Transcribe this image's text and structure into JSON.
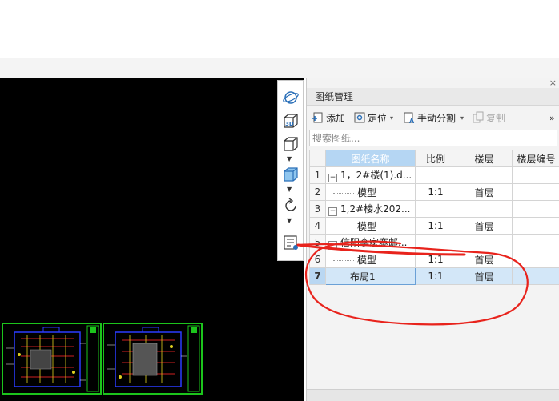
{
  "panel": {
    "title": "图纸管理",
    "close_icon": "×",
    "toolbar": {
      "add_label": "添加",
      "locate_label": "定位",
      "split_label": "手动分割",
      "copy_label": "复制",
      "more_icon": "»"
    },
    "search_placeholder": "搜索图纸..."
  },
  "table": {
    "headers": [
      "",
      "图纸名称",
      "比例",
      "楼层",
      "楼层编号"
    ],
    "rows": [
      {
        "no": "1",
        "name": "1，2#楼(1).d...",
        "scale": "",
        "floor": "",
        "floor_no": "",
        "expander": "−"
      },
      {
        "no": "2",
        "name": "模型",
        "scale": "1:1",
        "floor": "首层",
        "floor_no": ""
      },
      {
        "no": "3",
        "name": "1,2#楼水202...",
        "scale": "",
        "floor": "",
        "floor_no": "",
        "expander": "−"
      },
      {
        "no": "4",
        "name": "模型",
        "scale": "1:1",
        "floor": "首层",
        "floor_no": ""
      },
      {
        "no": "5",
        "name": "信阳李家寨邮...",
        "scale": "",
        "floor": "",
        "floor_no": "",
        "expander": "−"
      },
      {
        "no": "6",
        "name": "模型",
        "scale": "1:1",
        "floor": "首层",
        "floor_no": ""
      },
      {
        "no": "7",
        "name": "布局1",
        "scale": "1:1",
        "floor": "首层",
        "floor_no": ""
      }
    ]
  },
  "view_toolbar": {
    "icons": [
      "orbit-icon",
      "3d-view-icon",
      "cube-view-icon",
      "cube-solid-icon",
      "rotate-icon",
      "layer-list-icon"
    ],
    "cube_3d_label": "3D"
  },
  "colors": {
    "canvas": "#000000",
    "thumb_border": "#1cc41c",
    "annotation": "#e8231c",
    "selection": "#d3e7f8",
    "header_sorted": "#b5d6f3"
  }
}
